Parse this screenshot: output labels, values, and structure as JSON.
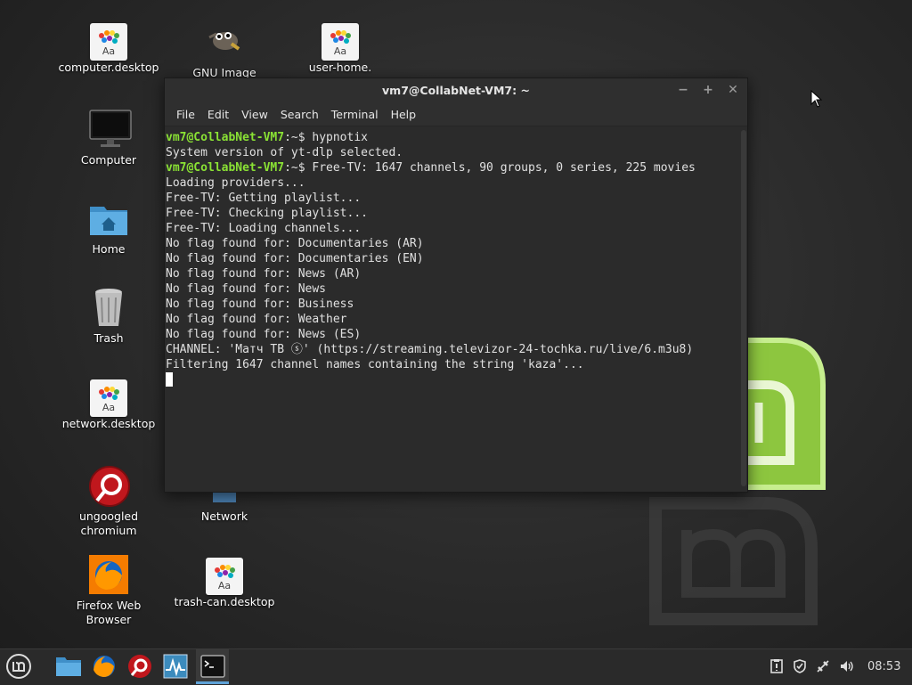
{
  "desktop": {
    "icons": [
      {
        "label": "computer.desktop"
      },
      {
        "label": "GNU Image"
      },
      {
        "label": "user-home."
      },
      {
        "label": "Computer"
      },
      {
        "label": "Home"
      },
      {
        "label": "Trash"
      },
      {
        "label": "network.desktop"
      },
      {
        "label": "ungoogled chromium"
      },
      {
        "label": "Network"
      },
      {
        "label": "Firefox Web Browser"
      },
      {
        "label": "trash-can.desktop"
      }
    ],
    "font_icon_text": "Aa"
  },
  "terminal": {
    "title": "vm7@CollabNet-VM7: ~",
    "controls": {
      "minimize": "−",
      "maximize": "+",
      "close": "✕"
    },
    "menu": [
      "File",
      "Edit",
      "View",
      "Search",
      "Terminal",
      "Help"
    ],
    "prompt": "vm7@CollabNet-VM7",
    "prompt_suffix": ":~$ ",
    "lines": [
      {
        "prompt": true,
        "text": "hypnotix"
      },
      {
        "prompt": false,
        "text": "System version of yt-dlp selected."
      },
      {
        "prompt": true,
        "text": "Free-TV: 1647 channels, 90 groups, 0 series, 225 movies"
      },
      {
        "prompt": false,
        "text": "Loading providers..."
      },
      {
        "prompt": false,
        "text": "Free-TV: Getting playlist..."
      },
      {
        "prompt": false,
        "text": "Free-TV: Checking playlist..."
      },
      {
        "prompt": false,
        "text": "Free-TV: Loading channels..."
      },
      {
        "prompt": false,
        "text": "No flag found for: Documentaries (AR)"
      },
      {
        "prompt": false,
        "text": "No flag found for: Documentaries (EN)"
      },
      {
        "prompt": false,
        "text": "No flag found for: News (AR)"
      },
      {
        "prompt": false,
        "text": "No flag found for: News"
      },
      {
        "prompt": false,
        "text": "No flag found for: Business"
      },
      {
        "prompt": false,
        "text": "No flag found for: Weather"
      },
      {
        "prompt": false,
        "text": "No flag found for: News (ES)"
      },
      {
        "prompt": false,
        "text": "CHANNEL: 'Матч ТВ ⓢ' (https://streaming.televizor-24-tochka.ru/live/6.m3u8)"
      },
      {
        "prompt": false,
        "text": "Filtering 1647 channel names containing the string 'kaza'..."
      }
    ]
  },
  "panel": {
    "launchers": [
      "menu-icon",
      "files-icon",
      "firefox-icon",
      "chromium-icon",
      "system-monitor-icon",
      "terminal-icon"
    ],
    "tray_icons": [
      "updates-icon",
      "shield-icon",
      "network-icon",
      "volume-icon"
    ],
    "clock": "08:53"
  },
  "colors": {
    "prompt": "#8ae234",
    "terminal_bg": "#2b2b2b",
    "mint_green": "#8dc63f"
  }
}
